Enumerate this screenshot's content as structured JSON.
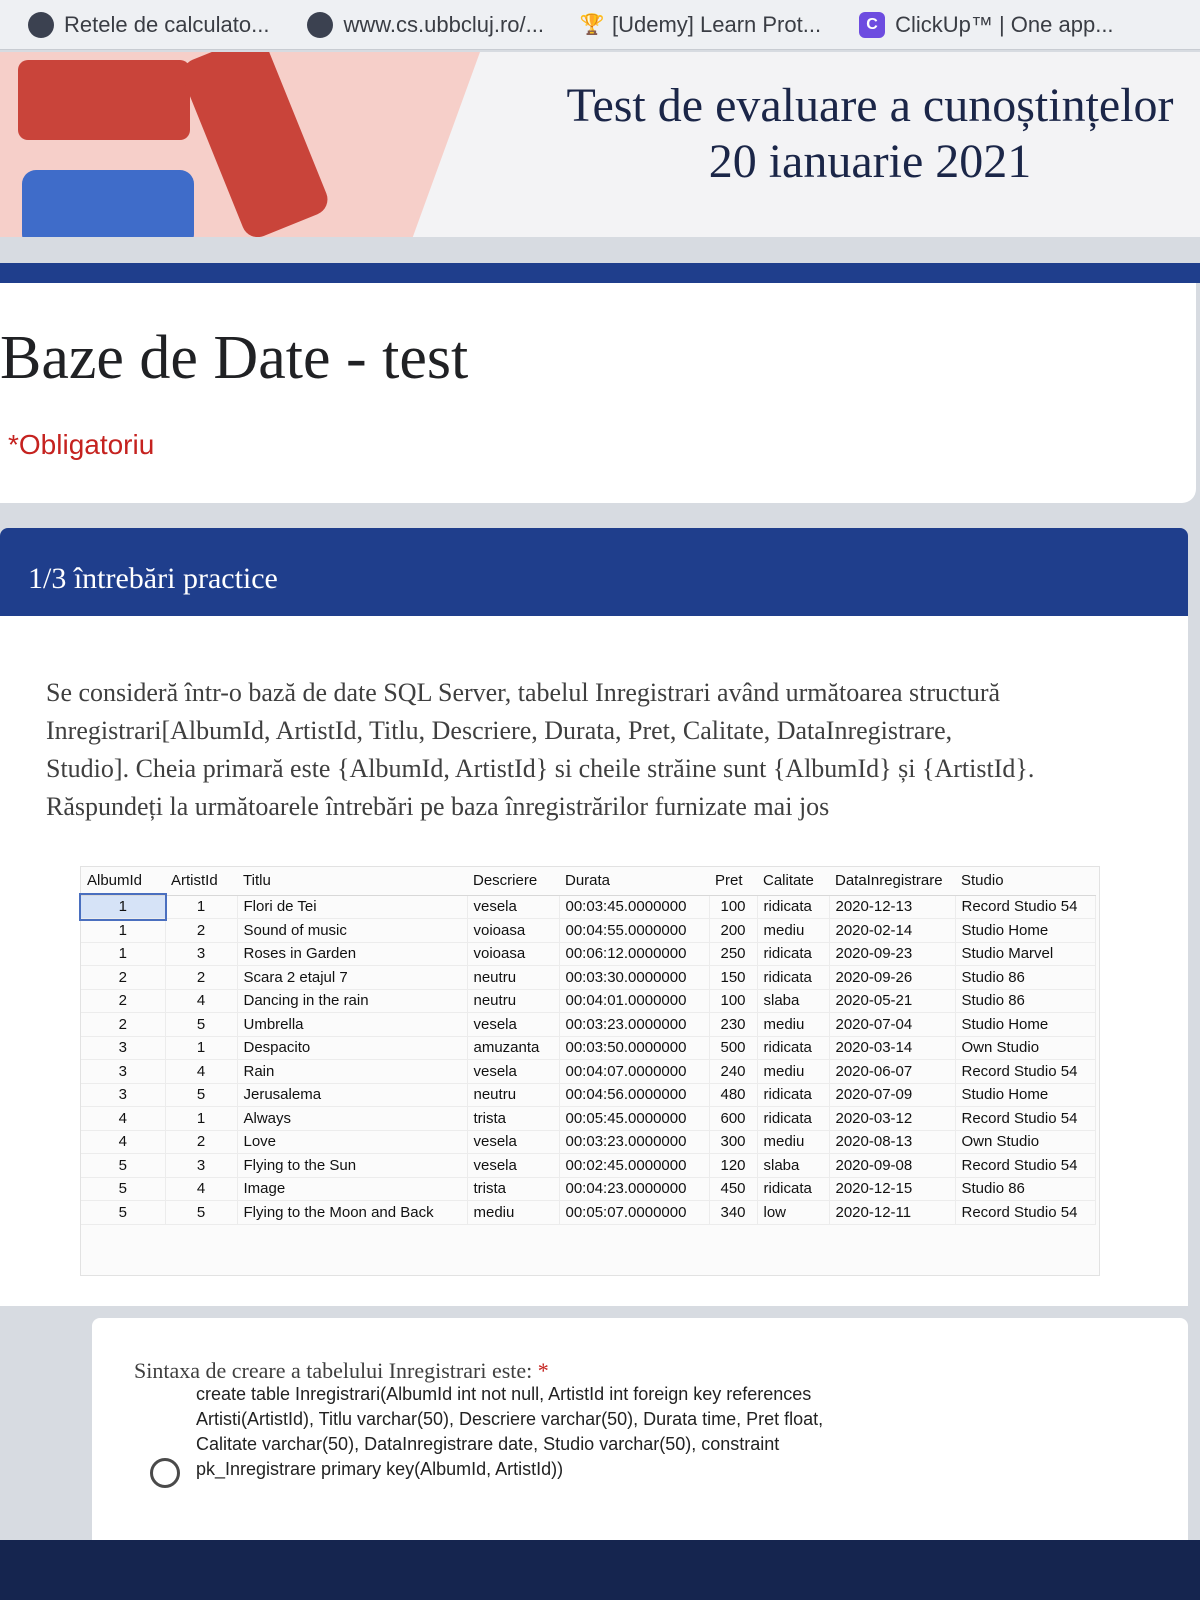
{
  "bookmarks": [
    {
      "label": "Retele de calculato...",
      "icon": "globe-icon"
    },
    {
      "label": "www.cs.ubbcluj.ro/...",
      "icon": "globe-icon"
    },
    {
      "label": "[Udemy] Learn Prot...",
      "icon": "trophy-icon"
    },
    {
      "label": "ClickUp™ | One app...",
      "icon": "clickup-icon"
    }
  ],
  "banner": {
    "line1": "Test de evaluare a cunoștințelor",
    "line2": "20 ianuarie 2021"
  },
  "form": {
    "title": "Baze de Date - test",
    "required_note": "*Obligatoriu"
  },
  "section": {
    "title": "1/3 întrebări practice",
    "description": [
      "Se consideră într-o bază de date SQL Server, tabelul Inregistrari având următoarea structură",
      "Inregistrari[AlbumId, ArtistId, Titlu, Descriere, Durata, Pret, Calitate, DataInregistrare,",
      "Studio]. Cheia primară este {AlbumId, ArtistId} si cheile străine sunt {AlbumId} și {ArtistId}.",
      "Răspundeți la următoarele întrebări pe baza înregistrărilor furnizate mai jos"
    ]
  },
  "table": {
    "headers": [
      "AlbumId",
      "ArtistId",
      "Titlu",
      "Descriere",
      "Durata",
      "Pret",
      "Calitate",
      "DataInregistrare",
      "Studio"
    ],
    "rows": [
      [
        "1",
        "1",
        "Flori de Tei",
        "vesela",
        "00:03:45.0000000",
        "100",
        "ridicata",
        "2020-12-13",
        "Record Studio 54"
      ],
      [
        "1",
        "2",
        "Sound of music",
        "voioasa",
        "00:04:55.0000000",
        "200",
        "mediu",
        "2020-02-14",
        "Studio Home"
      ],
      [
        "1",
        "3",
        "Roses in Garden",
        "voioasa",
        "00:06:12.0000000",
        "250",
        "ridicata",
        "2020-09-23",
        "Studio Marvel"
      ],
      [
        "2",
        "2",
        "Scara 2 etajul 7",
        "neutru",
        "00:03:30.0000000",
        "150",
        "ridicata",
        "2020-09-26",
        "Studio 86"
      ],
      [
        "2",
        "4",
        "Dancing in the rain",
        "neutru",
        "00:04:01.0000000",
        "100",
        "slaba",
        "2020-05-21",
        "Studio 86"
      ],
      [
        "2",
        "5",
        "Umbrella",
        "vesela",
        "00:03:23.0000000",
        "230",
        "mediu",
        "2020-07-04",
        "Studio Home"
      ],
      [
        "3",
        "1",
        "Despacito",
        "amuzanta",
        "00:03:50.0000000",
        "500",
        "ridicata",
        "2020-03-14",
        "Own Studio"
      ],
      [
        "3",
        "4",
        "Rain",
        "vesela",
        "00:04:07.0000000",
        "240",
        "mediu",
        "2020-06-07",
        "Record Studio 54"
      ],
      [
        "3",
        "5",
        "Jerusalema",
        "neutru",
        "00:04:56.0000000",
        "480",
        "ridicata",
        "2020-07-09",
        "Studio Home"
      ],
      [
        "4",
        "1",
        "Always",
        "trista",
        "00:05:45.0000000",
        "600",
        "ridicata",
        "2020-03-12",
        "Record Studio 54"
      ],
      [
        "4",
        "2",
        "Love",
        "vesela",
        "00:03:23.0000000",
        "300",
        "mediu",
        "2020-08-13",
        "Own Studio"
      ],
      [
        "5",
        "3",
        "Flying to the Sun",
        "vesela",
        "00:02:45.0000000",
        "120",
        "slaba",
        "2020-09-08",
        "Record Studio 54"
      ],
      [
        "5",
        "4",
        "Image",
        "trista",
        "00:04:23.0000000",
        "450",
        "ridicata",
        "2020-12-15",
        "Studio 86"
      ],
      [
        "5",
        "5",
        "Flying to the Moon and Back",
        "mediu",
        "00:05:07.0000000",
        "340",
        "low",
        "2020-12-11",
        "Record Studio 54"
      ]
    ]
  },
  "question": {
    "title": "Sintaxa de creare a tabelului Inregistrari este:",
    "required_mark": "*",
    "option_lines": [
      "create table Inregistrari(AlbumId int not null, ArtistId int foreign key references",
      "Artisti(ArtistId), Titlu varchar(50), Descriere varchar(50), Durata time, Pret float,",
      "Calitate varchar(50), DataInregistrare date, Studio varchar(50), constraint",
      "pk_Inregistrare primary key(AlbumId, ArtistId))"
    ]
  },
  "colors": {
    "accent": "#1f3e8c",
    "required": "#c5221f",
    "banner_pink": "#f6cfc9"
  }
}
